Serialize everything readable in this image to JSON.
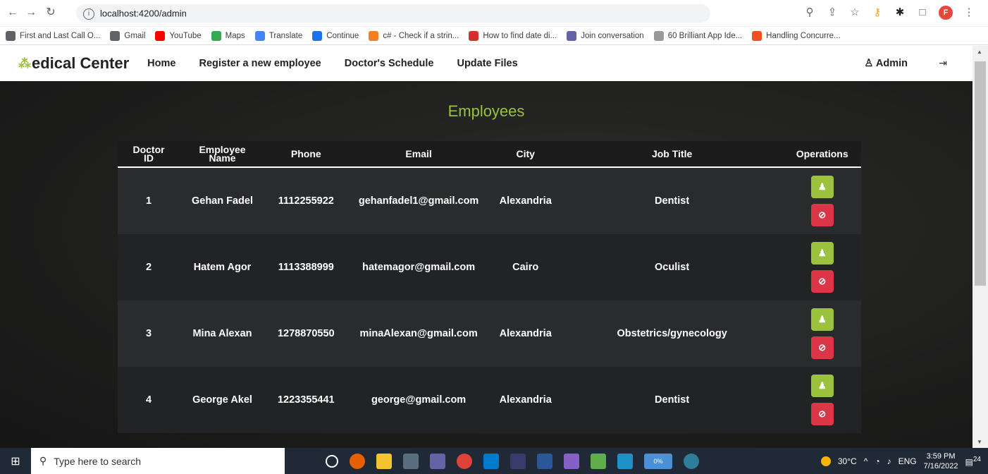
{
  "browser": {
    "url": "localhost:4200/admin",
    "bookmarks": [
      {
        "label": "First and Last Call O...",
        "color": "#5f6368"
      },
      {
        "label": "Gmail",
        "color": "#5f6368"
      },
      {
        "label": "YouTube",
        "color": "#ff0000"
      },
      {
        "label": "Maps",
        "color": "#34a853"
      },
      {
        "label": "Translate",
        "color": "#4285f4"
      },
      {
        "label": "Continue",
        "color": "#1a73e8"
      },
      {
        "label": "c# - Check if a strin...",
        "color": "#f48024"
      },
      {
        "label": "How to find date di...",
        "color": "#d32f2f"
      },
      {
        "label": "Join conversation",
        "color": "#6264a7"
      },
      {
        "label": "60 Brilliant App Ide...",
        "color": "#999999"
      },
      {
        "label": "Handling Concurre...",
        "color": "#f25022"
      }
    ],
    "profile_letter": "F"
  },
  "navbar": {
    "brand_rest": "edical Center",
    "items": [
      "Home",
      "Register a new employee",
      "Doctor's Schedule",
      "Update Files"
    ],
    "admin_label": "Admin"
  },
  "page": {
    "title": "Employees",
    "columns": [
      "Doctor ID",
      "Employee Name",
      "Phone",
      "Email",
      "City",
      "Job Title",
      "Operations"
    ],
    "rows": [
      {
        "id": "1",
        "name": "Gehan Fadel",
        "phone": "1112255922",
        "email": "gehanfadel1@gmail.com",
        "city": "Alexandria",
        "job": "Dentist"
      },
      {
        "id": "2",
        "name": "Hatem Agor",
        "phone": "1113388999",
        "email": "hatemagor@gmail.com",
        "city": "Cairo",
        "job": "Oculist"
      },
      {
        "id": "3",
        "name": "Mina Alexan",
        "phone": "1278870550",
        "email": "minaAlexan@gmail.com",
        "city": "Alexandria",
        "job": "Obstetrics/gynecology"
      },
      {
        "id": "4",
        "name": "George Akel",
        "phone": "1223355441",
        "email": "george@gmail.com",
        "city": "Alexandria",
        "job": "Dentist"
      }
    ]
  },
  "taskbar": {
    "search_placeholder": "Type here to search",
    "battery": "0%",
    "weather": "30°C",
    "lang": "ENG",
    "time": "3:59 PM",
    "date": "7/16/2022",
    "notifications": "24"
  },
  "colors": {
    "accent": "#9bc23c",
    "danger": "#dc3545"
  }
}
